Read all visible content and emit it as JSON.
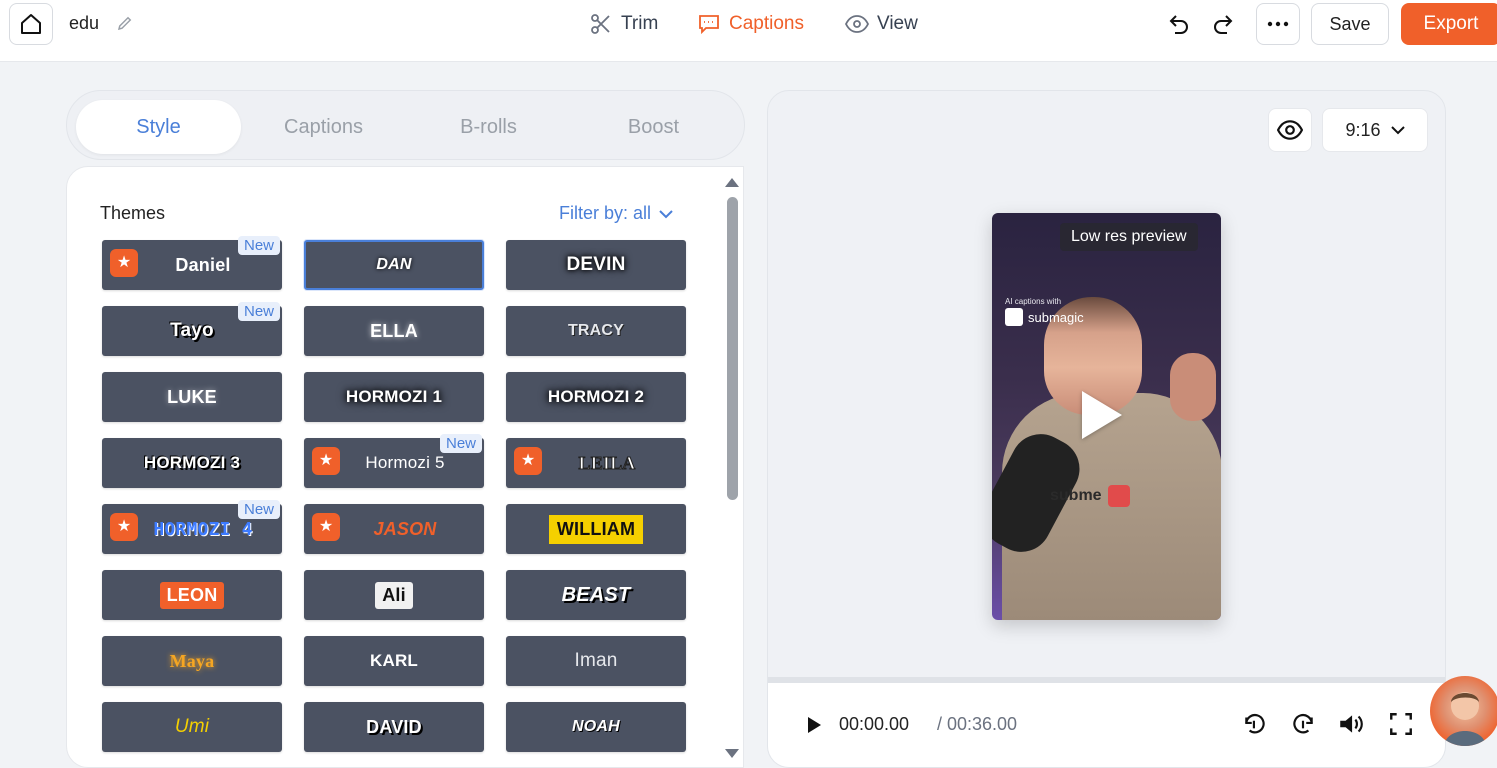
{
  "topbar": {
    "project_name": "edu",
    "nav": [
      {
        "label": "Trim",
        "icon": "scissors-icon"
      },
      {
        "label": "Captions",
        "icon": "captions-icon",
        "active": true
      },
      {
        "label": "View",
        "icon": "eye-icon"
      }
    ],
    "save_label": "Save",
    "export_label": "Export",
    "accent_color": "#f0602a"
  },
  "tabs": [
    {
      "label": "Style",
      "active": true
    },
    {
      "label": "Captions"
    },
    {
      "label": "B-rolls"
    },
    {
      "label": "Boost"
    }
  ],
  "themes": {
    "title": "Themes",
    "filter_label": "Filter by: all",
    "new_badge": "New",
    "items": [
      {
        "label": "Daniel",
        "star": true,
        "new": true
      },
      {
        "label": "DAN",
        "selected": true
      },
      {
        "label": "DEVIN"
      },
      {
        "label": "Tayo",
        "new": true
      },
      {
        "label": "ELLA"
      },
      {
        "label": "TRACY"
      },
      {
        "label": "LUKE"
      },
      {
        "label": "HORMOZI 1"
      },
      {
        "label": "HORMOZI 2"
      },
      {
        "label": "HORMOZI 3"
      },
      {
        "label": "Hormozi 5",
        "star": true,
        "new": true
      },
      {
        "label": "LEILA",
        "star": true
      },
      {
        "label": "HORMOZI 4",
        "star": true,
        "new": true
      },
      {
        "label": "JASON",
        "star": true
      },
      {
        "label": "WILLIAM"
      },
      {
        "label": "LEON"
      },
      {
        "label": "Ali"
      },
      {
        "label": "BEAST"
      },
      {
        "label": "Maya"
      },
      {
        "label": "KARL"
      },
      {
        "label": "Iman"
      },
      {
        "label": "Umi"
      },
      {
        "label": "DAVID"
      },
      {
        "label": "NOAH"
      }
    ]
  },
  "preview": {
    "ratio": "9:16",
    "low_res_label": "Low res preview",
    "ai_caption_text": "AI captions with",
    "brand": "submagic",
    "current_time": "00:00.00",
    "total_time": "/ 00:36.00"
  }
}
